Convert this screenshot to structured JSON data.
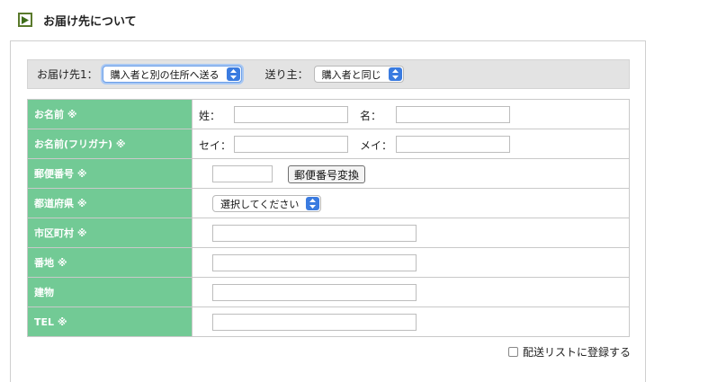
{
  "section_title": "お届け先について",
  "bar": {
    "dest_label": "お届け先1：",
    "dest_select_value": "購入者と別の住所へ送る",
    "sender_label": "送り主：",
    "sender_select_value": "購入者と同じ"
  },
  "rows": {
    "name": {
      "label": "お名前 ※",
      "sei": "姓：",
      "mei": "名："
    },
    "kana": {
      "label": "お名前(フリガナ) ※",
      "sei": "セイ：",
      "mei": "メイ："
    },
    "postal": {
      "label": "郵便番号 ※",
      "button": "郵便番号変換"
    },
    "pref": {
      "label": "都道府県 ※",
      "select_value": "選択してください"
    },
    "city": {
      "label": "市区町村 ※"
    },
    "address": {
      "label": "番地 ※"
    },
    "building": {
      "label": "建物"
    },
    "tel": {
      "label": "TEL ※"
    }
  },
  "register_label": "配送リストに登録する",
  "colors": {
    "key_bg": "#72ca95",
    "accent": "#3a7be0",
    "bar_bg": "#e3e3e3"
  }
}
